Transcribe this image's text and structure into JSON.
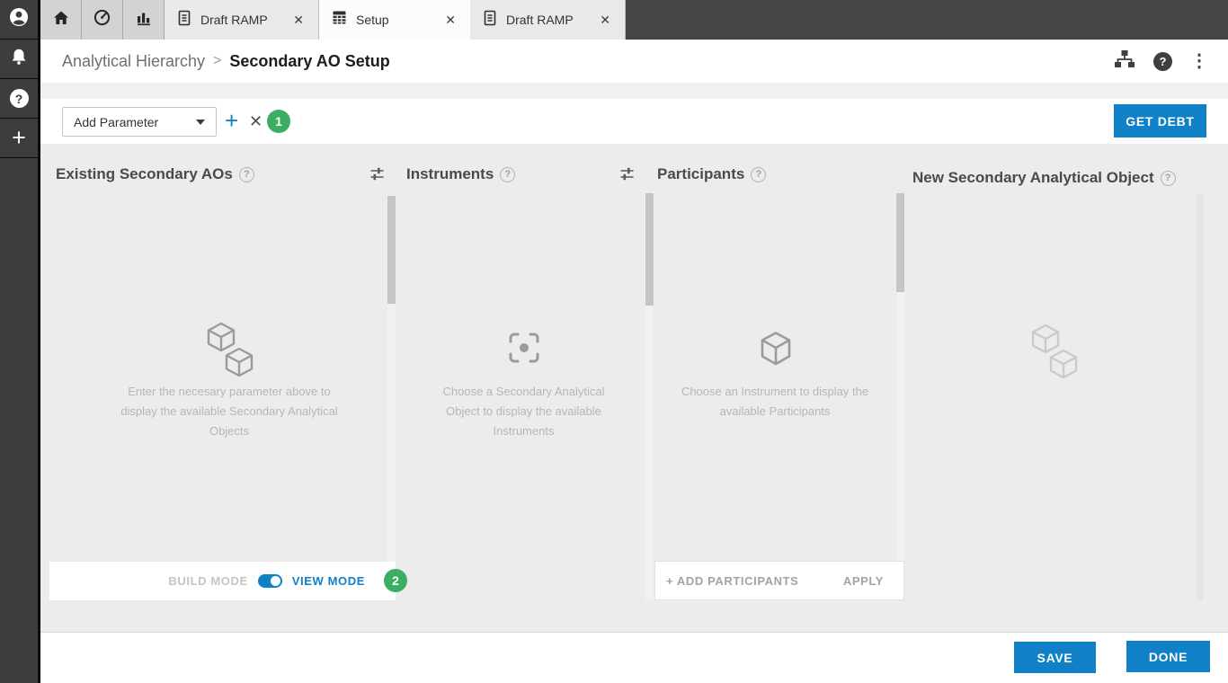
{
  "colors": {
    "accent_blue": "#1081c6",
    "badge_green": "#3cae63",
    "topbar_dark": "#484645",
    "sidebar_dark": "#3e3c3c",
    "canvas_gray": "#ececec",
    "empty_text_gray": "#b6b6b6"
  },
  "glyphs": {
    "question": "?",
    "plus": "+",
    "close": "✕",
    "kebab": "⋮",
    "breadcrumb_separator": ">"
  },
  "topbar": {
    "tabs": [
      {
        "label": "Draft RAMP"
      },
      {
        "label": "Setup"
      },
      {
        "label": "Draft RAMP"
      }
    ]
  },
  "breadcrumb": {
    "parent": "Analytical Hierarchy",
    "current": "Secondary AO Setup"
  },
  "toolbar": {
    "add_parameter": {
      "value": "Add Parameter"
    },
    "step_badge": "1",
    "get_debt_label": "GET DEBT"
  },
  "columns": {
    "existing": {
      "title": "Existing Secondary AOs",
      "empty_text": "Enter the necesary parameter above to display the available Secondary Analytical Objects",
      "footer": {
        "build_mode_label": "BUILD MODE",
        "view_mode_label": "VIEW MODE",
        "step_badge": "2"
      }
    },
    "instruments": {
      "title": "Instruments",
      "empty_text": "Choose a Secondary Analytical Object to display the available Instruments"
    },
    "participants": {
      "title": "Participants",
      "empty_text": "Choose an Instrument to display the available Participants",
      "footer": {
        "add_participants_label": "+ ADD PARTICIPANTS",
        "apply_label": "APPLY"
      }
    },
    "new_ao": {
      "title": "New Secondary Analytical Object"
    }
  },
  "action_bar": {
    "save_label": "SAVE",
    "done_label": "DONE"
  }
}
